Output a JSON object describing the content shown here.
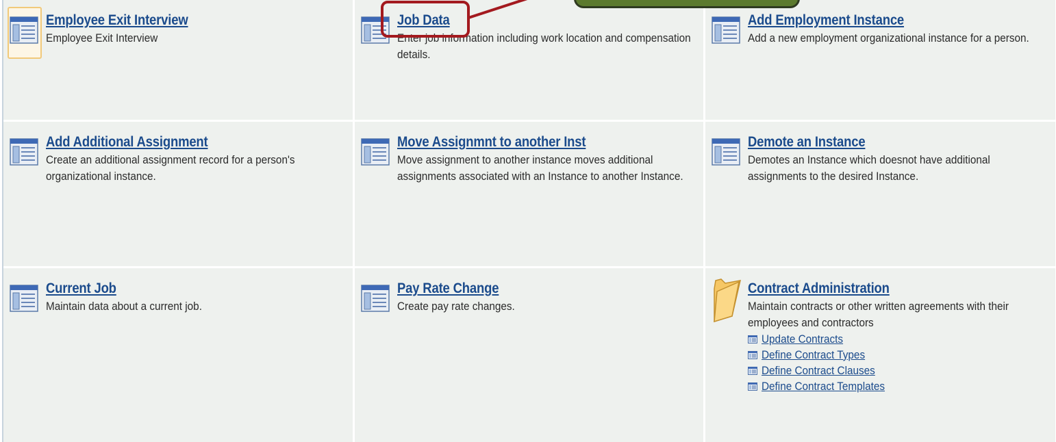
{
  "tiles": [
    {
      "title": "Employee Exit Interview",
      "description": "Employee Exit Interview",
      "icon": "page-icon"
    },
    {
      "title": "Job Data",
      "description": "Enter job information including work location and compensation details.",
      "icon": "page-icon"
    },
    {
      "title": "Add Employment Instance",
      "description": "Add a new employment organizational instance for a person.",
      "icon": "page-icon"
    },
    {
      "title": "Add Additional Assignment",
      "description": "Create an additional assignment record for a person's organizational instance.",
      "icon": "page-icon"
    },
    {
      "title": "Move Assignmnt to another Inst",
      "description": "Move assignment to another instance moves additional assignments associated with an Instance to another Instance.",
      "icon": "page-icon"
    },
    {
      "title": "Demote an Instance",
      "description": "Demotes an Instance which doesnot have additional assignments to the desired Instance.",
      "icon": "page-icon"
    },
    {
      "title": "Current Job",
      "description": "Maintain data about a current job.",
      "icon": "page-icon"
    },
    {
      "title": "Pay Rate Change",
      "description": "Create pay rate changes.",
      "icon": "page-icon"
    },
    {
      "title": "Contract Administration",
      "description": "Maintain contracts or other written agreements with their employees and contractors",
      "icon": "folder-icon",
      "sublinks": [
        "Update Contracts",
        "Define Contract Types",
        "Define Contract Clauses",
        "Define Contract Templates"
      ]
    }
  ],
  "colors": {
    "link": "#1b4b8c",
    "cell_background": "#eef1ee",
    "highlight_box": "#a31a1f",
    "callout_fill": "#5c7a2e"
  }
}
